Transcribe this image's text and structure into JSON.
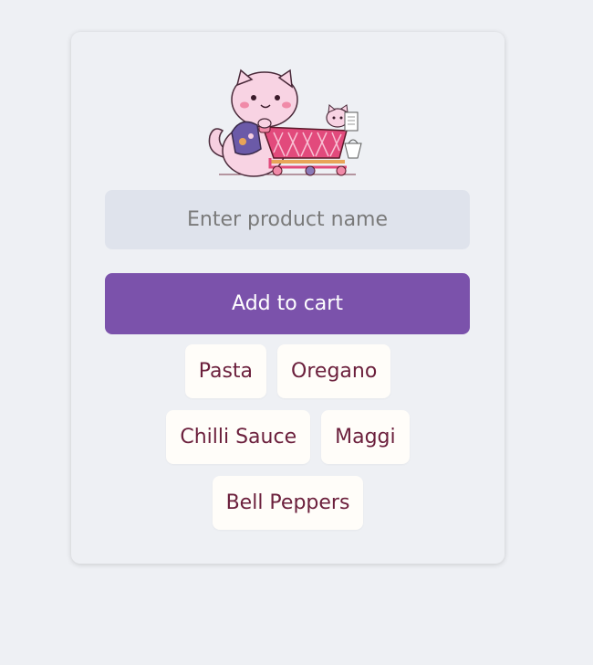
{
  "form": {
    "input_placeholder": "Enter product name",
    "input_value": "",
    "button_label": "Add to cart"
  },
  "cart": {
    "items": [
      {
        "label": "Pasta"
      },
      {
        "label": "Oregano"
      },
      {
        "label": "Chilli Sauce"
      },
      {
        "label": "Maggi"
      },
      {
        "label": "Bell Peppers"
      }
    ]
  },
  "logo": {
    "icon": "cat-shopping-cart-icon"
  },
  "colors": {
    "page_background": "#eef0f4",
    "input_background": "#dfe3ec",
    "button_background": "#7b52ab",
    "item_background": "#fffdf9",
    "item_text": "#6b1f3c"
  }
}
